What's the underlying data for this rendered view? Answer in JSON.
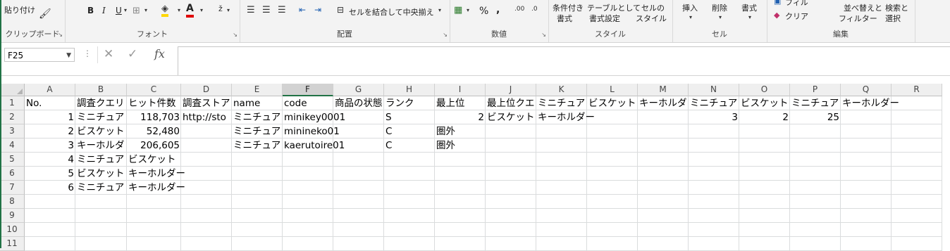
{
  "ribbon": {
    "clipboard": {
      "paste": "貼り付け",
      "label": "クリップボード"
    },
    "font": {
      "bold": "B",
      "italic": "I",
      "underline": "U",
      "label": "フォント"
    },
    "alignment": {
      "merge_center": "セルを結合して中央揃え",
      "label": "配置"
    },
    "number": {
      "percent": "%",
      "comma": ",",
      "label": "数値"
    },
    "styles": {
      "conditional": [
        "条件付き",
        "書式"
      ],
      "table": [
        "テーブルとして",
        "書式設定"
      ],
      "cell_styles": [
        "セルの",
        "スタイル"
      ],
      "label": "スタイル"
    },
    "cells": {
      "insert": "挿入",
      "delete": "削除",
      "format": "書式",
      "label": "セル"
    },
    "editing": {
      "fill": "フィル",
      "clear": "クリア",
      "sort": [
        "並べ替えと",
        "フィルター"
      ],
      "find": [
        "検索と",
        "選択"
      ],
      "label": "編集"
    }
  },
  "formula_bar": {
    "name_box": "F25",
    "fx": "fx",
    "content": ""
  },
  "sheet": {
    "selected_column": "F",
    "columns": [
      "A",
      "B",
      "C",
      "D",
      "E",
      "F",
      "G",
      "H",
      "I",
      "J",
      "K",
      "L",
      "M",
      "N",
      "O",
      "P",
      "Q",
      "R"
    ],
    "rows": [
      "1",
      "2",
      "3",
      "4",
      "5",
      "6",
      "7",
      "8",
      "9",
      "10",
      "11"
    ],
    "cells": {
      "A1": "No.",
      "B1": "調査クエリ",
      "C1": "ヒット件数",
      "D1": "調査ストア",
      "E1": "name",
      "F1": "code",
      "G1": "商品の状態",
      "H1": "ランク",
      "I1": "最上位",
      "J1": "最上位クエ",
      "K1": "ミニチュア",
      "L1": "ビスケット",
      "M1": "キーホルダ",
      "N1": "ミニチュア",
      "O1": "ビスケット",
      "P1": "ミニチュア",
      "Q1": "キーホルダー",
      "A2": "1",
      "B2": "ミニチュア",
      "C2": "118,703",
      "D2": "http://sto",
      "E2": "ミニチュア",
      "F2": "minikey0001",
      "H2": "S",
      "I2": "2",
      "J2": "ビスケット",
      "K2": "キーホルダー",
      "N2": "3",
      "O2": "2",
      "P2": "25",
      "A3": "2",
      "B3": "ビスケット",
      "C3": "52,480",
      "E3": "ミニチュア",
      "F3": "minineko01",
      "H3": "C",
      "I3": "圏外",
      "A4": "3",
      "B4": "キーホルダ",
      "C4": "206,605",
      "E4": "ミニチュア",
      "F4": "kaerutoire01",
      "H4": "C",
      "I4": "圏外",
      "A5": "4",
      "B5": "ミニチュア",
      "C5": "ビスケット",
      "A6": "5",
      "B6": "ビスケット",
      "C6": "キーホルダー",
      "A7": "6",
      "B7": "ミニチュア",
      "C7": "キーホルダー"
    }
  }
}
